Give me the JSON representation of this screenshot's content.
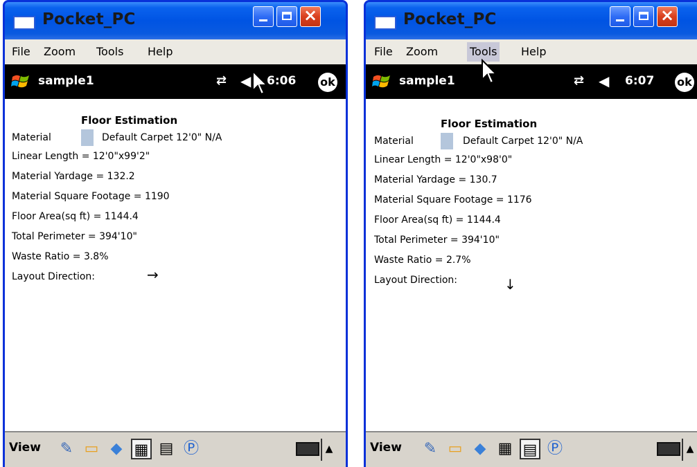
{
  "left": {
    "window_title": "Pocket_PC",
    "menu": [
      "File",
      "Zoom",
      "Tools",
      "Help"
    ],
    "app_name": "sample1",
    "clock": "6:06",
    "ok_label": "ok",
    "report": {
      "title": "Floor Estimation",
      "material_label": "Material",
      "material_value": "Default Carpet 12'0\" N/A",
      "linear_length": "Linear Length = 12'0\"x99'2\"",
      "material_yardage": "Material Yardage = 132.2",
      "material_square_footage": "Material Square Footage = 1190",
      "floor_area": "Floor Area(sq ft) = 1144.4",
      "total_perimeter": "Total Perimeter = 394'10\"",
      "waste_ratio": "Waste Ratio = 3.8%",
      "layout_direction_label": "Layout Direction:",
      "layout_direction_arrow": "→"
    },
    "bottom_label": "View"
  },
  "right": {
    "window_title": "Pocket_PC",
    "menu": [
      "File",
      "Zoom",
      "Tools",
      "Help"
    ],
    "highlighted_menu": "Tools",
    "app_name": "sample1",
    "clock": "6:07",
    "ok_label": "ok",
    "report": {
      "title": "Floor Estimation",
      "material_label": "Material",
      "material_value": "Default Carpet 12'0\" N/A",
      "linear_length": "Linear Length = 12'0\"x98'0\"",
      "material_yardage": "Material Yardage = 130.7",
      "material_square_footage": "Material Square Footage = 1176",
      "floor_area": "Floor Area(sq ft) = 1144.4",
      "total_perimeter": "Total Perimeter = 394'10\"",
      "waste_ratio": "Waste Ratio = 2.7%",
      "layout_direction_label": "Layout Direction:",
      "layout_direction_arrow": "↓"
    },
    "bottom_label": "View"
  },
  "colors": {
    "titlebar_blue": "#0054e3",
    "close_red": "#d9401e",
    "material_swatch": "#b4c6dc",
    "menu_highlight": "#c8c8d8"
  }
}
